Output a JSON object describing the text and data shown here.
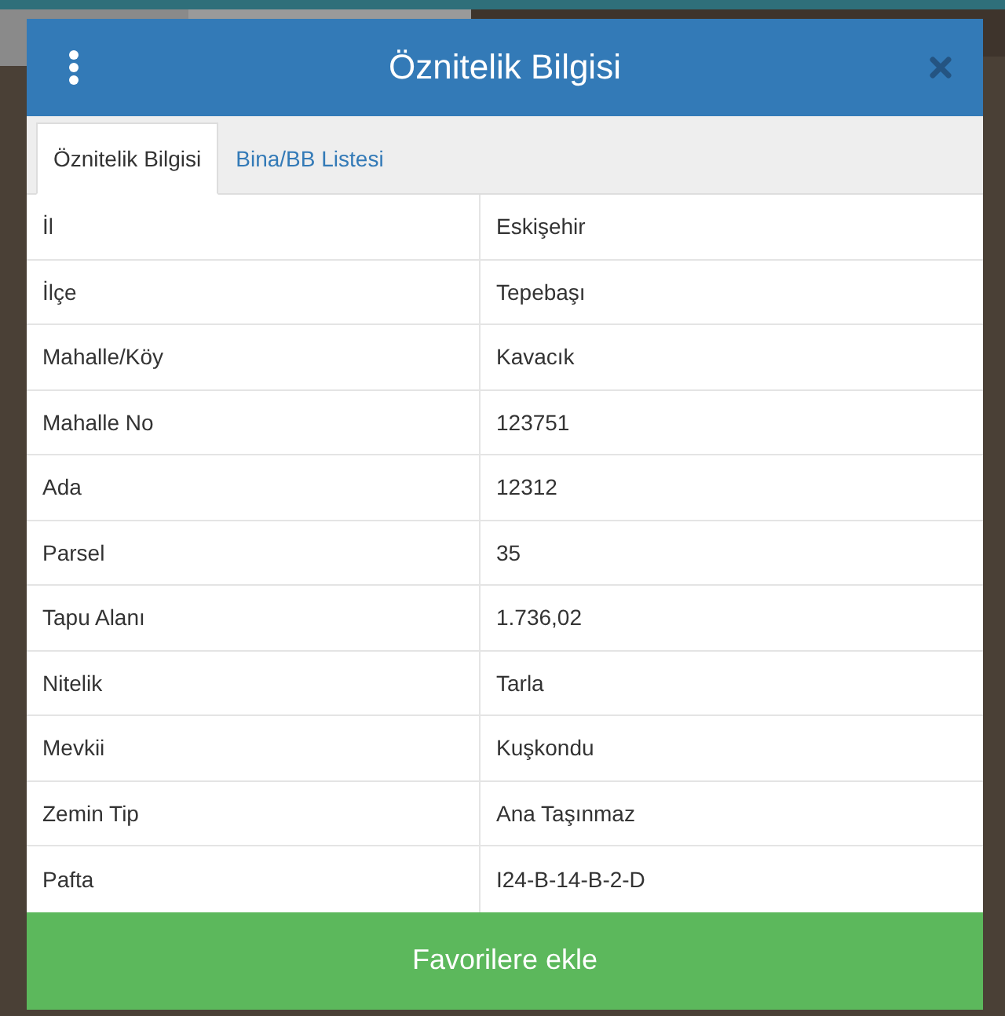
{
  "dialog": {
    "title": "Öznitelik Bilgisi"
  },
  "tabs": [
    {
      "label": "Öznitelik Bilgisi",
      "selected": true
    },
    {
      "label": "Bina/BB Listesi",
      "selected": false
    }
  ],
  "rows": [
    {
      "label": "İl",
      "value": "Eskişehir"
    },
    {
      "label": "İlçe",
      "value": "Tepebaşı"
    },
    {
      "label": "Mahalle/Köy",
      "value": "Kavacık"
    },
    {
      "label": "Mahalle No",
      "value": "123751"
    },
    {
      "label": "Ada",
      "value": "12312"
    },
    {
      "label": "Parsel",
      "value": "35"
    },
    {
      "label": "Tapu Alanı",
      "value": "1.736,02"
    },
    {
      "label": "Nitelik",
      "value": "Tarla"
    },
    {
      "label": "Mevkii",
      "value": "Kuşkondu"
    },
    {
      "label": "Zemin Tip",
      "value": "Ana Taşınmaz"
    },
    {
      "label": "Pafta",
      "value": "I24-B-14-B-2-D"
    }
  ],
  "button": {
    "label": "Favorilere ekle"
  }
}
